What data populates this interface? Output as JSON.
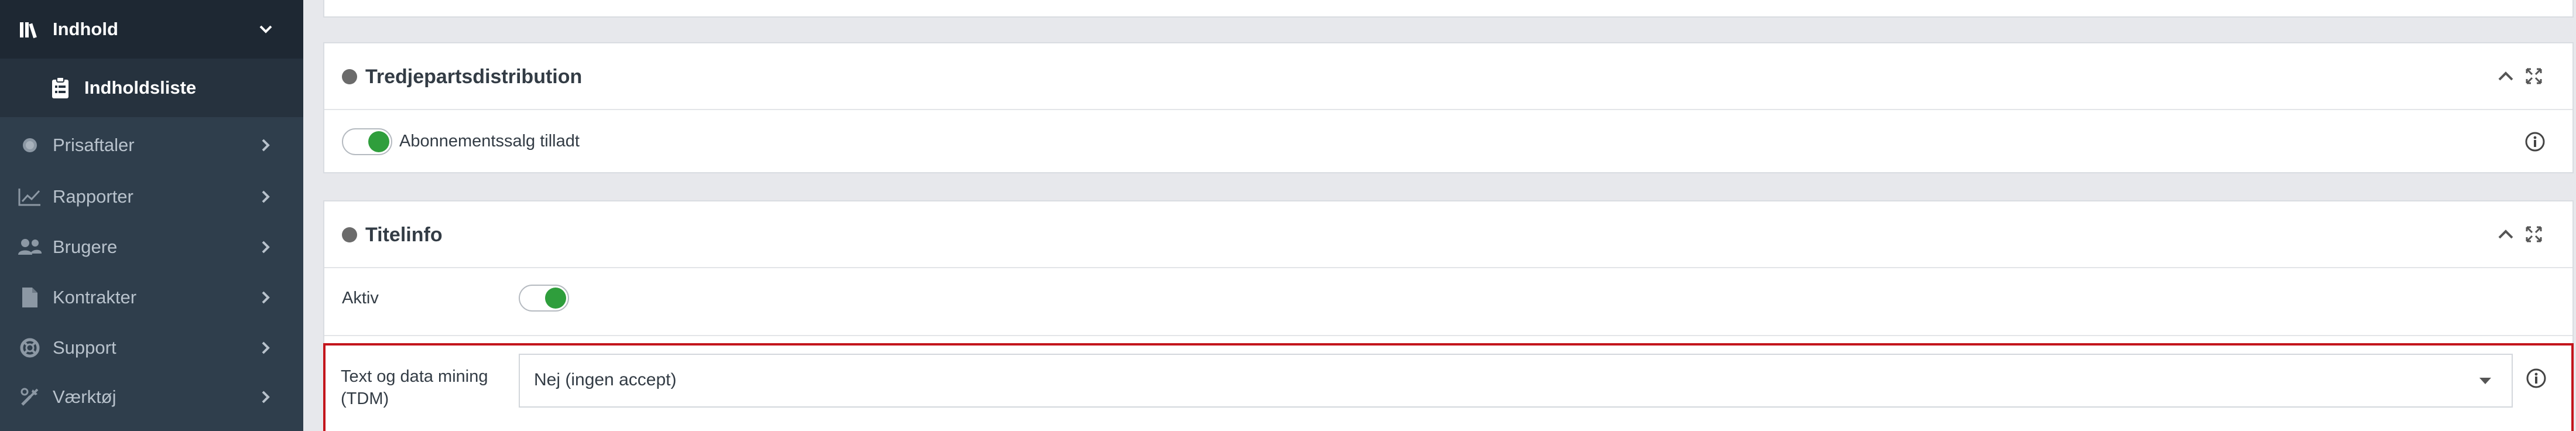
{
  "sidebar": {
    "items": [
      {
        "label": "Indhold",
        "icon": "library-icon"
      },
      {
        "label": "Indholdsliste",
        "icon": "clipboard-list-icon"
      },
      {
        "label": "Prisaftaler",
        "icon": "coins-icon"
      },
      {
        "label": "Rapporter",
        "icon": "line-chart-icon"
      },
      {
        "label": "Brugere",
        "icon": "users-icon"
      },
      {
        "label": "Kontrakter",
        "icon": "file-icon"
      },
      {
        "label": "Support",
        "icon": "lifebuoy-icon"
      },
      {
        "label": "Værktøj",
        "icon": "tools-icon"
      }
    ]
  },
  "panels": {
    "third_party": {
      "title": "Tredjepartsdistribution",
      "subscription_label": "Abonnementssalg tilladt",
      "subscription_enabled": true
    },
    "title_info": {
      "title": "Titelinfo",
      "active_label": "Aktiv",
      "active_enabled": true,
      "tdm_label": "Text og data mining (TDM)",
      "tdm_value": "Nej (ingen accept)"
    }
  },
  "colors": {
    "sidebar_bg": "#2f3e4c",
    "toggle_on": "#2f9e3c",
    "highlight_border": "#c3151c"
  }
}
